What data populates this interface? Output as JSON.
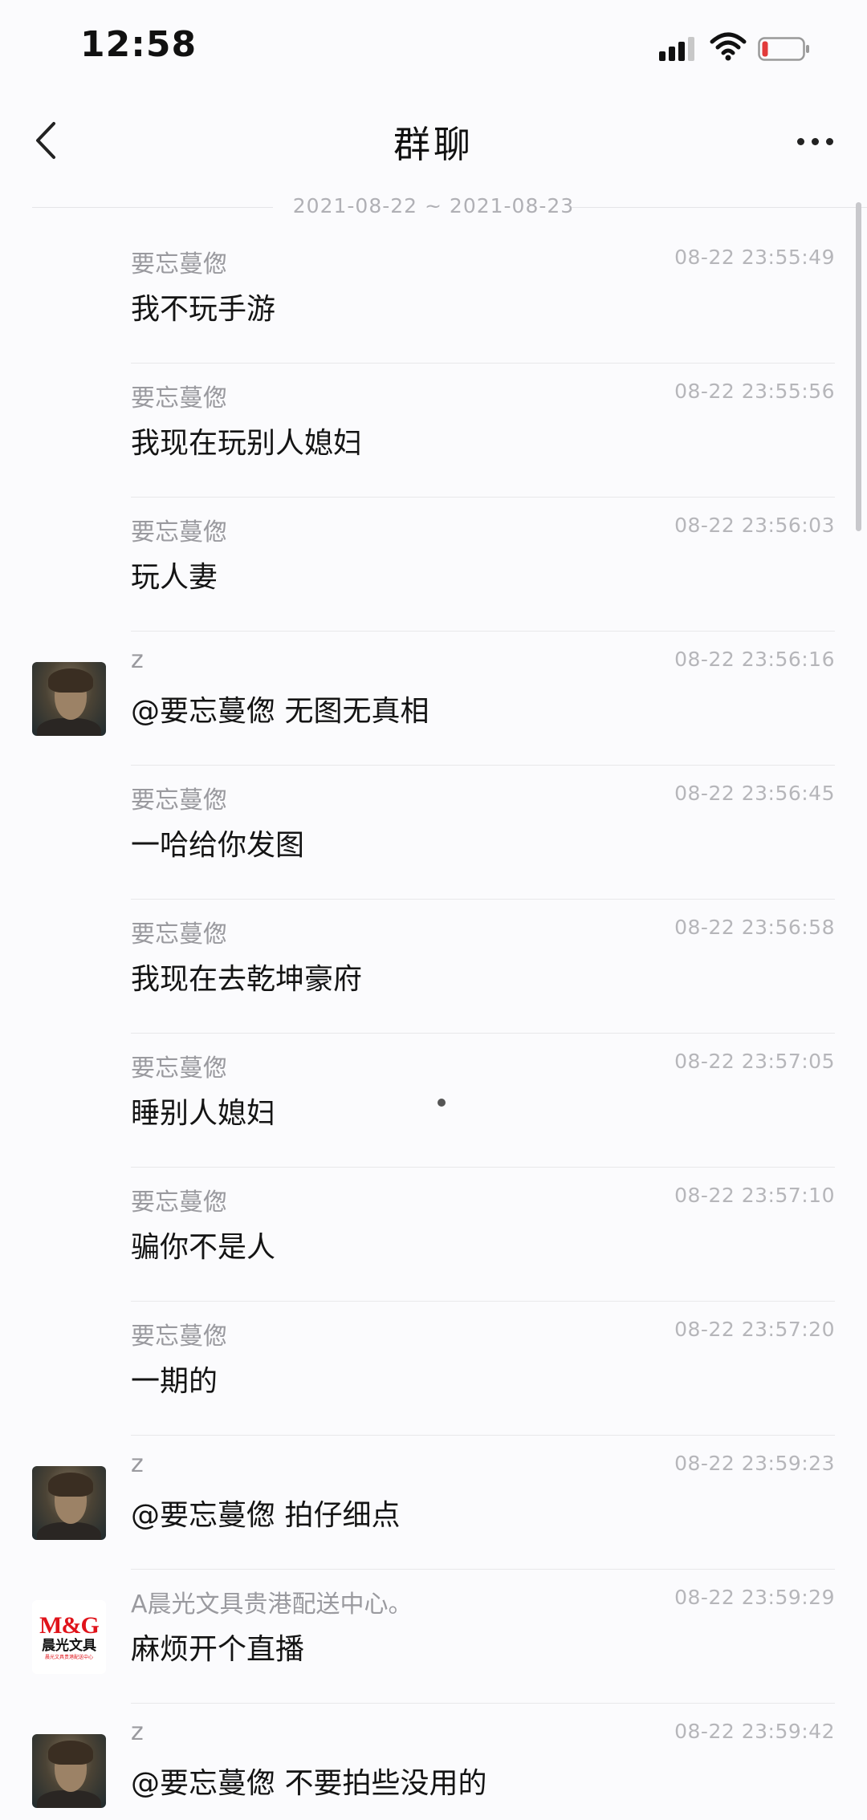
{
  "status_bar": {
    "time": "12:58",
    "icons": [
      "signal-icon",
      "wifi-icon",
      "battery-low-icon"
    ],
    "battery_color": "#e23b3b"
  },
  "nav": {
    "title": "群聊",
    "back_icon": "chevron-left-icon",
    "more_icon": "more-dots-icon"
  },
  "date_range": "2021-08-22 ~ 2021-08-23",
  "messages": [
    {
      "sender": "要忘蔓偬",
      "time": "08-22 23:55:49",
      "text": "我不玩手游",
      "avatar": ""
    },
    {
      "sender": "要忘蔓偬",
      "time": "08-22 23:55:56",
      "text": "我现在玩别人媳妇",
      "avatar": ""
    },
    {
      "sender": "要忘蔓偬",
      "time": "08-22 23:56:03",
      "text": "玩人妻",
      "avatar": ""
    },
    {
      "sender": "z",
      "time": "08-22 23:56:16",
      "text": "@要忘蔓偬 无图无真相",
      "avatar": "photo"
    },
    {
      "sender": "要忘蔓偬",
      "time": "08-22 23:56:45",
      "text": "一哈给你发图",
      "avatar": ""
    },
    {
      "sender": "要忘蔓偬",
      "time": "08-22 23:56:58",
      "text": "我现在去乾坤豪府",
      "avatar": ""
    },
    {
      "sender": "要忘蔓偬",
      "time": "08-22 23:57:05",
      "text": "睡别人媳妇",
      "avatar": ""
    },
    {
      "sender": "要忘蔓偬",
      "time": "08-22 23:57:10",
      "text": "骗你不是人",
      "avatar": ""
    },
    {
      "sender": "要忘蔓偬",
      "time": "08-22 23:57:20",
      "text": "一期的",
      "avatar": ""
    },
    {
      "sender": "z",
      "time": "08-22 23:59:23",
      "text": "@要忘蔓偬 拍仔细点",
      "avatar": "photo"
    },
    {
      "sender": "A晨光文具贵港配送中心。",
      "time": "08-22 23:59:29",
      "text": "麻烦开个直播",
      "avatar": "logo"
    },
    {
      "sender": "z",
      "time": "08-22 23:59:42",
      "text": "@要忘蔓偬 不要拍些没用的",
      "avatar": "photo"
    }
  ],
  "logo_avatar": {
    "brand": "M&G",
    "name": "晨光文具",
    "sub": "晨光文具贵港配送中心"
  }
}
